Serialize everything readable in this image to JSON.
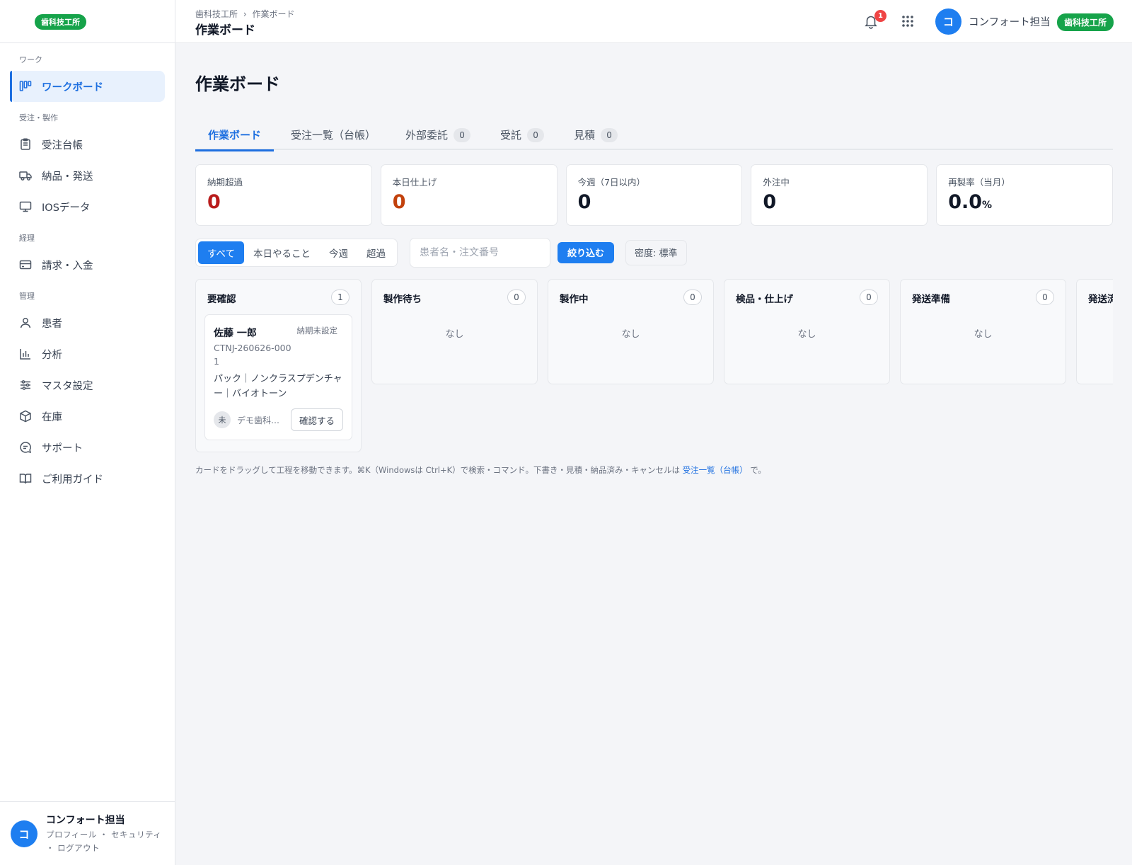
{
  "sidebar": {
    "org_badge": "歯科技工所",
    "sections": [
      {
        "label": "ワーク",
        "items": [
          {
            "label": "ワークボード",
            "icon": "board-icon",
            "active": true
          }
        ]
      },
      {
        "label": "受注・製作",
        "items": [
          {
            "label": "受注台帳",
            "icon": "ledger-icon"
          },
          {
            "label": "納品・発送",
            "icon": "truck-icon"
          },
          {
            "label": "IOSデータ",
            "icon": "monitor-icon"
          }
        ]
      },
      {
        "label": "経理",
        "items": [
          {
            "label": "請求・入金",
            "icon": "credit-card-icon"
          }
        ]
      },
      {
        "label": "管理",
        "items": [
          {
            "label": "患者",
            "icon": "person-icon"
          },
          {
            "label": "分析",
            "icon": "chart-icon"
          },
          {
            "label": "マスタ設定",
            "icon": "sliders-icon"
          },
          {
            "label": "在庫",
            "icon": "box-icon"
          },
          {
            "label": "サポート",
            "icon": "chat-icon"
          },
          {
            "label": "ご利用ガイド",
            "icon": "book-icon"
          }
        ]
      }
    ],
    "user": {
      "initial": "コ",
      "name": "コンフォート担当",
      "links": "プロフィール ・ セキュリティ ・ ログアウト"
    }
  },
  "header": {
    "breadcrumb_root": "歯科技工所",
    "breadcrumb_sep": "›",
    "breadcrumb_current": "作業ボード",
    "title": "作業ボード",
    "notification_count": "1",
    "avatar_initial": "コ",
    "user_name": "コンフォート担当",
    "org_badge": "歯科技工所"
  },
  "main": {
    "page_title": "作業ボード",
    "tabs": [
      {
        "label": "作業ボード",
        "active": true
      },
      {
        "label": "受注一覧（台帳）"
      },
      {
        "label": "外部委託",
        "count": "0"
      },
      {
        "label": "受託",
        "count": "0"
      },
      {
        "label": "見積",
        "count": "0"
      }
    ],
    "stats": [
      {
        "label": "納期超過",
        "value": "0",
        "color": "#b91c1c"
      },
      {
        "label": "本日仕上げ",
        "value": "0",
        "color": "#c2410c"
      },
      {
        "label": "今週（7日以内）",
        "value": "0"
      },
      {
        "label": "外注中",
        "value": "0"
      },
      {
        "label": "再製率（当月）",
        "value": "0.0",
        "unit": "%"
      }
    ],
    "filters": {
      "segments": [
        {
          "label": "すべて",
          "active": true
        },
        {
          "label": "本日やること"
        },
        {
          "label": "今週"
        },
        {
          "label": "超過"
        }
      ],
      "search_placeholder": "患者名・注文番号",
      "search_value": "",
      "filter_button": "絞り込む",
      "density_button": "密度: 標準"
    },
    "columns": [
      {
        "title": "要確認",
        "count": "1"
      },
      {
        "title": "製作待ち",
        "count": "0",
        "empty": "なし"
      },
      {
        "title": "製作中",
        "count": "0",
        "empty": "なし"
      },
      {
        "title": "検品・仕上げ",
        "count": "0",
        "empty": "なし"
      },
      {
        "title": "発送準備",
        "count": "0",
        "empty": "なし"
      },
      {
        "title": "発送済"
      }
    ],
    "card": {
      "patient": "佐藤 一郎",
      "due": "納期未設定",
      "order_id": "CTNJ-260626-0001",
      "description": "パック｜ノンクラスプデンチャー｜バイオトーン",
      "status_mark": "未",
      "clinic": "デモ歯科…",
      "confirm_button": "確認する"
    },
    "hint": {
      "text_before": "カードをドラッグして工程を移動できます。⌘K（Windowsは Ctrl+K）で検索・コマンド。下書き・見積・納品済み・キャンセルは",
      "link": "受注一覧（台帳）",
      "text_after": "で。"
    }
  },
  "colors": {
    "accent": "#1e7ef0",
    "org_green": "#16a34a",
    "overdue_red": "#b91c1c",
    "today_orange": "#c2410c"
  }
}
